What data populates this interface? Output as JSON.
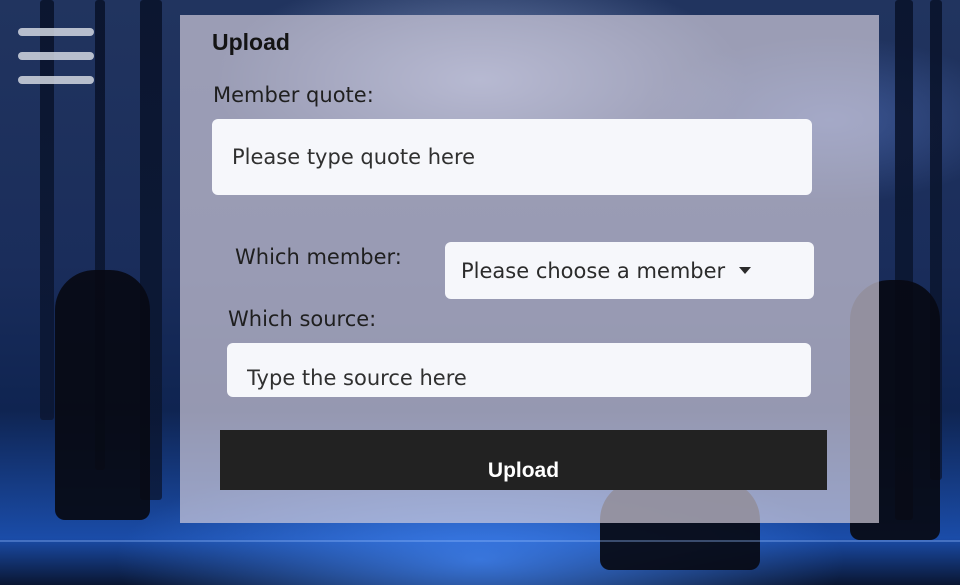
{
  "menu": {
    "icon": "hamburger-menu-icon"
  },
  "form": {
    "title": "Upload",
    "quote_label": "Member quote:",
    "quote_placeholder": "Please type quote here",
    "member_label": "Which member:",
    "member_select_value": "Please choose a member",
    "member_select_icon": "caret-down-icon",
    "source_label": "Which source:",
    "source_placeholder": "Type the source here",
    "submit_label": "Upload"
  },
  "colors": {
    "panel_bg": "#d6d0df",
    "button_bg": "#222222",
    "button_text": "#ffffff",
    "input_bg": "#f6f7fb"
  }
}
